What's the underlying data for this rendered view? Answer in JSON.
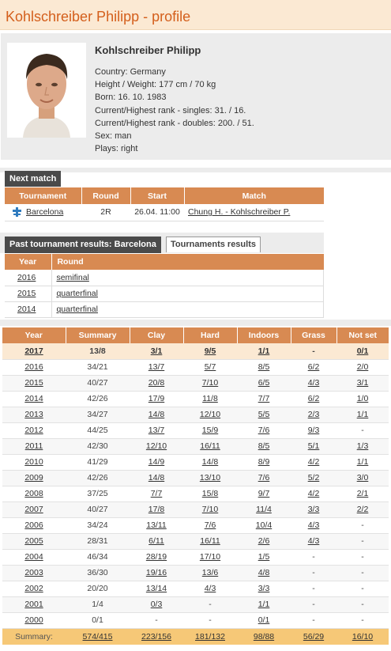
{
  "page": {
    "title": "Kohlschreiber Philipp - profile"
  },
  "profile": {
    "name": "Kohlschreiber Philipp",
    "country": "Country: Germany",
    "height_weight": "Height / Weight: 177 cm / 70 kg",
    "born": "Born: 16. 10. 1983",
    "rank_singles": "Current/Highest rank - singles: 31. / 16.",
    "rank_doubles": "Current/Highest rank - doubles: 200. / 51.",
    "sex": "Sex: man",
    "plays": "Plays: right"
  },
  "next_match": {
    "header": "Next match",
    "columns": [
      "Tournament",
      "Round",
      "Start",
      "Match"
    ],
    "row": {
      "tournament": "Barcelona",
      "round": "2R",
      "start": "26.04. 11:00",
      "match": "Chung H. - Kohlschreiber P."
    },
    "icon": "clay-court-icon"
  },
  "past_results": {
    "tab_active": "Past tournament results: Barcelona",
    "tab_other": "Tournaments results",
    "columns": [
      "Year",
      "Round"
    ],
    "rows": [
      {
        "year": "2016",
        "round": "semifinal"
      },
      {
        "year": "2015",
        "round": "quarterfinal"
      },
      {
        "year": "2014",
        "round": "quarterfinal"
      }
    ]
  },
  "yearly": {
    "columns": [
      "Year",
      "Summary",
      "Clay",
      "Hard",
      "Indoors",
      "Grass",
      "Not set"
    ],
    "rows": [
      [
        "2017",
        "13/8",
        "3/1",
        "9/5",
        "1/1",
        "-",
        "0/1"
      ],
      [
        "2016",
        "34/21",
        "13/7",
        "5/7",
        "8/5",
        "6/2",
        "2/0"
      ],
      [
        "2015",
        "40/27",
        "20/8",
        "7/10",
        "6/5",
        "4/3",
        "3/1"
      ],
      [
        "2014",
        "42/26",
        "17/9",
        "11/8",
        "7/7",
        "6/2",
        "1/0"
      ],
      [
        "2013",
        "34/27",
        "14/8",
        "12/10",
        "5/5",
        "2/3",
        "1/1"
      ],
      [
        "2012",
        "44/25",
        "13/7",
        "15/9",
        "7/6",
        "9/3",
        "-"
      ],
      [
        "2011",
        "42/30",
        "12/10",
        "16/11",
        "8/5",
        "5/1",
        "1/3"
      ],
      [
        "2010",
        "41/29",
        "14/9",
        "14/8",
        "8/9",
        "4/2",
        "1/1"
      ],
      [
        "2009",
        "42/26",
        "14/8",
        "13/10",
        "7/6",
        "5/2",
        "3/0"
      ],
      [
        "2008",
        "37/25",
        "7/7",
        "15/8",
        "9/7",
        "4/2",
        "2/1"
      ],
      [
        "2007",
        "40/27",
        "17/8",
        "7/10",
        "11/4",
        "3/3",
        "2/2"
      ],
      [
        "2006",
        "34/24",
        "13/11",
        "7/6",
        "10/4",
        "4/3",
        "-"
      ],
      [
        "2005",
        "28/31",
        "6/11",
        "16/11",
        "2/6",
        "4/3",
        "-"
      ],
      [
        "2004",
        "46/34",
        "28/19",
        "17/10",
        "1/5",
        "-",
        "-"
      ],
      [
        "2003",
        "36/30",
        "19/16",
        "13/6",
        "4/8",
        "-",
        "-"
      ],
      [
        "2002",
        "20/20",
        "13/14",
        "4/3",
        "3/3",
        "-",
        "-"
      ],
      [
        "2001",
        "1/4",
        "0/3",
        "-",
        "1/1",
        "-",
        "-"
      ],
      [
        "2000",
        "0/1",
        "-",
        "-",
        "0/1",
        "-",
        "-"
      ]
    ],
    "summary": [
      "Summary:",
      "574/415",
      "223/156",
      "181/132",
      "98/88",
      "56/29",
      "16/10"
    ]
  }
}
